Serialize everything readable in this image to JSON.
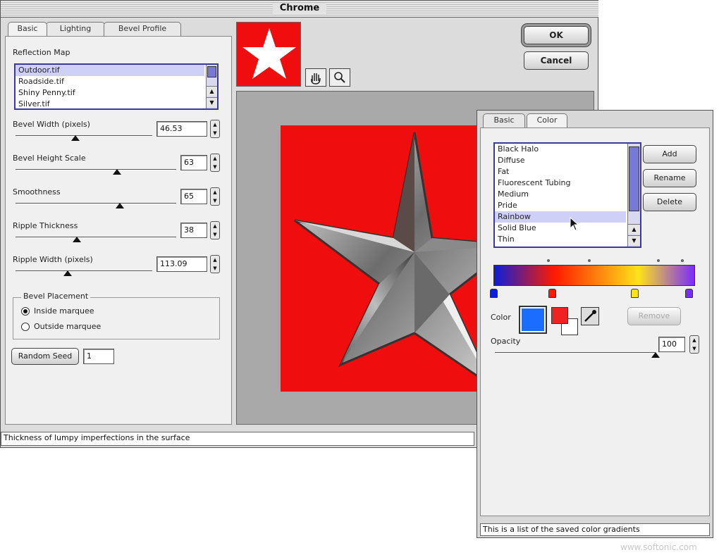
{
  "window": {
    "title": "Chrome"
  },
  "tabs": [
    "Basic",
    "Lighting",
    "Bevel Profile"
  ],
  "reflection_map": {
    "label": "Reflection Map",
    "items": [
      "Outdoor.tif",
      "Roadside.tif",
      "Shiny Penny.tif",
      "Silver.tif"
    ],
    "selected_index": 0
  },
  "params": [
    {
      "label": "Bevel Width (pixels)",
      "value": "46.53",
      "level": 0.44
    },
    {
      "label": "Bevel Height Scale",
      "value": "63",
      "level": 0.63
    },
    {
      "label": "Smoothness",
      "value": "65",
      "level": 0.65
    },
    {
      "label": "Ripple Thickness",
      "value": "38",
      "level": 0.38
    },
    {
      "label": "Ripple Width (pixels)",
      "value": "113.09",
      "level": 0.38
    }
  ],
  "bevel_placement": {
    "label": "Bevel Placement",
    "options": [
      "Inside marquee",
      "Outside marquee"
    ],
    "selected_index": 0
  },
  "random_seed": {
    "button": "Random Seed",
    "value": "1"
  },
  "buttons": {
    "ok": "OK",
    "cancel": "Cancel"
  },
  "status": "Thickness of lumpy imperfections in the surface",
  "colors": {
    "preview_red": "#f00d0d",
    "list_border": "#3a3a9a",
    "selection": "#cfd0f7"
  },
  "icons": [
    "star-preview-icon",
    "hand-tool-icon",
    "zoom-tool-icon",
    "eyedropper-icon",
    "cursor-arrow-icon"
  ],
  "gradient_dialog": {
    "tabs": [
      "Basic",
      "Color"
    ],
    "items": [
      "Black Halo",
      "Diffuse",
      "Fat",
      "Fluorescent Tubing",
      "Medium",
      "Pride",
      "Rainbow",
      "Solid Blue",
      "Thin"
    ],
    "selected_index": 6,
    "buttons": {
      "add": "Add",
      "rename": "Rename",
      "delete": "Delete",
      "remove": "Remove"
    },
    "color_label": "Color",
    "opacity_label": "Opacity",
    "opacity_value": "100",
    "opacity_level": 1.0,
    "gradient_colors": [
      "#0c1fd6",
      "#ff1a00",
      "#ffe21a",
      "#7a2cff"
    ],
    "status": "This is a list of the saved color gradients"
  },
  "watermark": "www.softonic.com"
}
